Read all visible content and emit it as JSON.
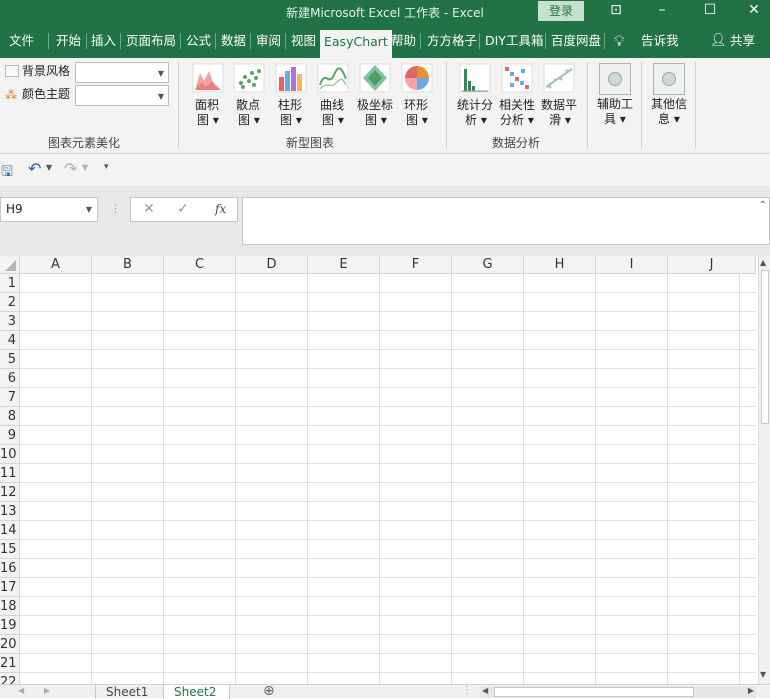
{
  "window": {
    "title": "新建Microsoft Excel 工作表  -  Excel",
    "login_label": "登录",
    "controls": [
      "restore-ribbon-icon",
      "minimize-icon",
      "maximize-icon",
      "close-icon"
    ]
  },
  "tabs": [
    {
      "label": "文件"
    },
    {
      "label": "开始"
    },
    {
      "label": "插入"
    },
    {
      "label": "页面布局"
    },
    {
      "label": "公式"
    },
    {
      "label": "数据"
    },
    {
      "label": "审阅"
    },
    {
      "label": "视图"
    },
    {
      "label": "EasyChart",
      "active": true
    },
    {
      "label": "帮助"
    },
    {
      "label": "方方格子"
    },
    {
      "label": "DIY工具箱"
    },
    {
      "label": "百度网盘"
    },
    {
      "label": "告诉我"
    }
  ],
  "share_label": "共享",
  "ribbon": {
    "beautify": {
      "background_style": "背景风格",
      "color_theme": "颜色主题",
      "group_label": "图表元素美化"
    },
    "new_chart": {
      "buttons": [
        {
          "line1": "面积",
          "line2": "图"
        },
        {
          "line1": "散点",
          "line2": "图"
        },
        {
          "line1": "柱形",
          "line2": "图"
        },
        {
          "line1": "曲线",
          "line2": "图"
        },
        {
          "line1": "极坐标",
          "line2": "图"
        },
        {
          "line1": "环形",
          "line2": "图"
        }
      ],
      "group_label": "新型图表"
    },
    "analysis": {
      "buttons": [
        {
          "line1": "统计分",
          "line2": "析"
        },
        {
          "line1": "相关性",
          "line2": "分析"
        },
        {
          "line1": "数据平",
          "line2": "滑"
        }
      ],
      "group_label": "数据分析"
    },
    "tools": {
      "assist": {
        "line1": "辅助工",
        "line2": "具"
      },
      "other": {
        "line1": "其他信",
        "line2": "息"
      }
    }
  },
  "formula_bar": {
    "name_box": "H9",
    "fx": "fx",
    "formula": ""
  },
  "columns": [
    "A",
    "B",
    "C",
    "D",
    "E",
    "F",
    "G",
    "H",
    "I",
    "J"
  ],
  "rows": [
    "1",
    "2",
    "3",
    "4",
    "5",
    "6",
    "7",
    "8",
    "9",
    "10",
    "11",
    "12",
    "13",
    "14",
    "15",
    "16",
    "17",
    "18",
    "19",
    "20",
    "21",
    "22"
  ],
  "sheets": [
    {
      "label": "Sheet1"
    },
    {
      "label": "Sheet2",
      "active": true
    }
  ],
  "colors": {
    "excel_green": "#217346",
    "ribbon_bg": "#f3f3f3"
  }
}
